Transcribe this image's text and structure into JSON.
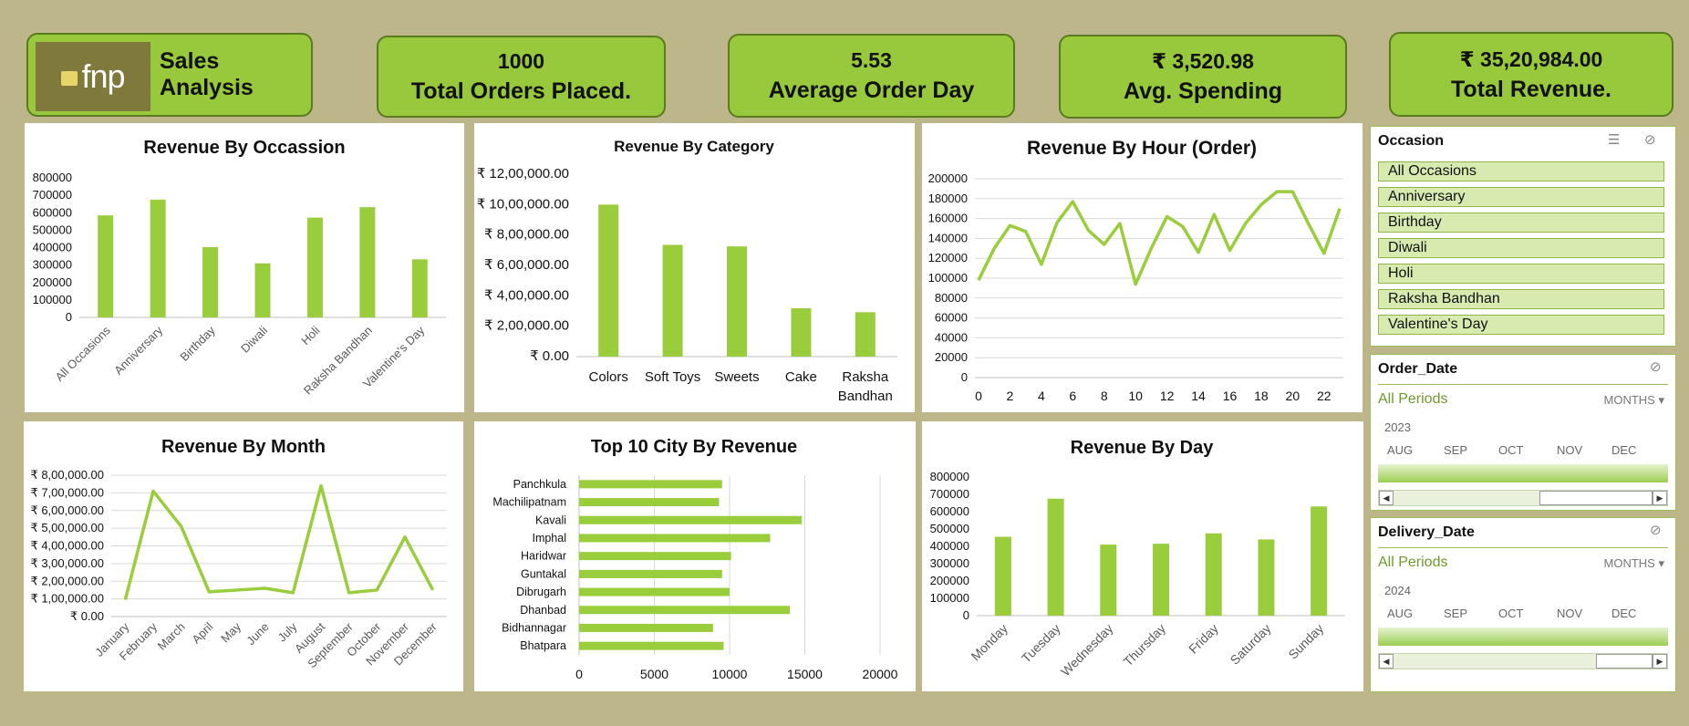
{
  "brand": {
    "logo_text": "fnp",
    "title": "Sales Analysis"
  },
  "kpis": [
    {
      "value": "1000",
      "label": "Total Orders Placed."
    },
    {
      "value": "5.53",
      "label": "Average Order Day"
    },
    {
      "value": "₹ 3,520.98",
      "label": "Avg. Spending"
    },
    {
      "value": "₹ 35,20,984.00",
      "label": "Total Revenue."
    }
  ],
  "colors": {
    "bar": "#9acd3c",
    "grid": "#d9d9d9",
    "axis": "#bfbfbf",
    "text": "#595959"
  },
  "chart_data": [
    {
      "type": "bar",
      "title": "Revenue By Occassion",
      "categories": [
        "All Occasions",
        "Anniversary",
        "Birthday",
        "Diwali",
        "Holi",
        "Raksha Bandhan",
        "Valentine's Day"
      ],
      "values": [
        585000,
        675000,
        403000,
        310000,
        572000,
        632000,
        333000
      ],
      "ylim": [
        0,
        800000
      ],
      "ticks": [
        "0",
        "100000",
        "200000",
        "300000",
        "400000",
        "500000",
        "600000",
        "700000",
        "800000"
      ]
    },
    {
      "type": "bar",
      "title": "Revenue By Category",
      "categories": [
        "Colors",
        "Soft Toys",
        "Sweets",
        "Cake",
        "Raksha Bandhan"
      ],
      "values": [
        1000000,
        735000,
        725000,
        318000,
        292000
      ],
      "ylim": [
        0,
        1200000
      ],
      "ticks": [
        "₹ 0.00",
        "₹ 2,00,000.00",
        "₹ 4,00,000.00",
        "₹ 6,00,000.00",
        "₹ 8,00,000.00",
        "₹ 10,00,000.00",
        "₹ 12,00,000.00"
      ]
    },
    {
      "type": "line",
      "title": "Revenue By Hour (Order)",
      "x": [
        0,
        1,
        2,
        3,
        4,
        5,
        6,
        7,
        8,
        9,
        10,
        11,
        12,
        13,
        14,
        15,
        16,
        17,
        18,
        19,
        20,
        21,
        22,
        23
      ],
      "values": [
        98000,
        130000,
        153000,
        147000,
        114000,
        156000,
        177000,
        148000,
        134000,
        155000,
        94000,
        130000,
        162000,
        152000,
        126000,
        164000,
        128000,
        155000,
        174000,
        187000,
        187000,
        155000,
        125000,
        170000
      ],
      "ylim": [
        0,
        200000
      ],
      "ticks": [
        "0",
        "20000",
        "40000",
        "60000",
        "80000",
        "100000",
        "120000",
        "140000",
        "160000",
        "180000",
        "200000"
      ],
      "xticks": [
        "0",
        "2",
        "4",
        "6",
        "8",
        "10",
        "12",
        "14",
        "16",
        "18",
        "20",
        "22"
      ]
    },
    {
      "type": "line",
      "title": "Revenue By Month",
      "categories": [
        "January",
        "February",
        "March",
        "April",
        "May",
        "June",
        "July",
        "August",
        "September",
        "October",
        "November",
        "December"
      ],
      "values": [
        95000,
        710000,
        510000,
        140000,
        150000,
        160000,
        135000,
        740000,
        135000,
        150000,
        450000,
        150000
      ],
      "ylim": [
        0,
        800000
      ],
      "ticks": [
        "₹ 0.00",
        "₹ 1,00,000.00",
        "₹ 2,00,000.00",
        "₹ 3,00,000.00",
        "₹ 4,00,000.00",
        "₹ 5,00,000.00",
        "₹ 6,00,000.00",
        "₹ 7,00,000.00",
        "₹ 8,00,000.00"
      ]
    },
    {
      "type": "bar",
      "orientation": "horizontal",
      "title": "Top 10 City By Revenue",
      "categories": [
        "Panchkula",
        "Machilipatnam",
        "Kavali",
        "Imphal",
        "Haridwar",
        "Guntakal",
        "Dibrugarh",
        "Dhanbad",
        "Bidhannagar",
        "Bhatpara"
      ],
      "values": [
        9500,
        9300,
        14800,
        12700,
        10100,
        9500,
        10000,
        14000,
        8900,
        9600
      ],
      "xlim": [
        0,
        20000
      ],
      "ticks": [
        "0",
        "5000",
        "10000",
        "15000",
        "20000"
      ]
    },
    {
      "type": "bar",
      "title": "Revenue By Day",
      "categories": [
        "Monday",
        "Tuesday",
        "Wednesday",
        "Thursday",
        "Friday",
        "Saturday",
        "Sunday"
      ],
      "values": [
        455000,
        675000,
        410000,
        415000,
        475000,
        440000,
        630000
      ],
      "ylim": [
        0,
        800000
      ],
      "ticks": [
        "0",
        "100000",
        "200000",
        "300000",
        "400000",
        "500000",
        "600000",
        "700000",
        "800000"
      ]
    }
  ],
  "occasion_slicer": {
    "title": "Occasion",
    "items": [
      "All Occasions",
      "Anniversary",
      "Birthday",
      "Diwali",
      "Holi",
      "Raksha Bandhan",
      "Valentine's Day"
    ]
  },
  "order_timeline": {
    "title": "Order_Date",
    "period": "All Periods",
    "level": "MONTHS",
    "year": "2023",
    "months": [
      "AUG",
      "SEP",
      "OCT",
      "NOV",
      "DEC"
    ]
  },
  "delivery_timeline": {
    "title": "Delivery_Date",
    "period": "All Periods",
    "level": "MONTHS",
    "year": "2024",
    "months": [
      "AUG",
      "SEP",
      "OCT",
      "NOV",
      "DEC"
    ]
  }
}
